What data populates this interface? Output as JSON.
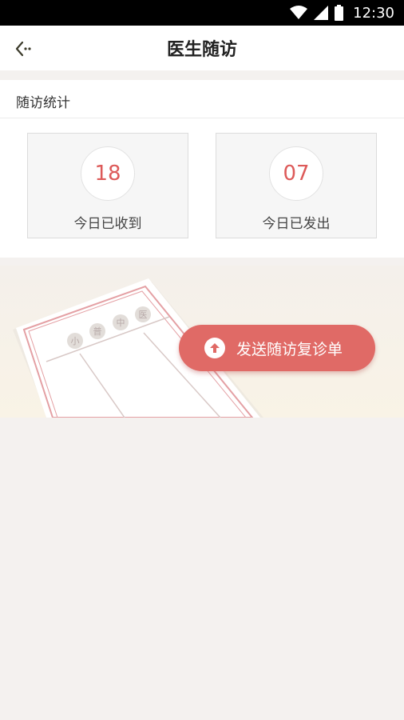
{
  "status_bar": {
    "time": "12:30"
  },
  "header": {
    "title": "医生随访",
    "back_icon": "back-arrow-icon"
  },
  "stats": {
    "section_title": "随访统计",
    "received": {
      "value": "18",
      "label": "今日已收到"
    },
    "sent": {
      "value": "07",
      "label": "今日已发出"
    }
  },
  "banner": {
    "paper_stamps": [
      "小",
      "普",
      "中",
      "医"
    ],
    "send_button_label": "发送随访复诊单"
  },
  "colors": {
    "accent": "#dd5a59",
    "button": "#e06a66",
    "background": "#f4f1ef"
  }
}
